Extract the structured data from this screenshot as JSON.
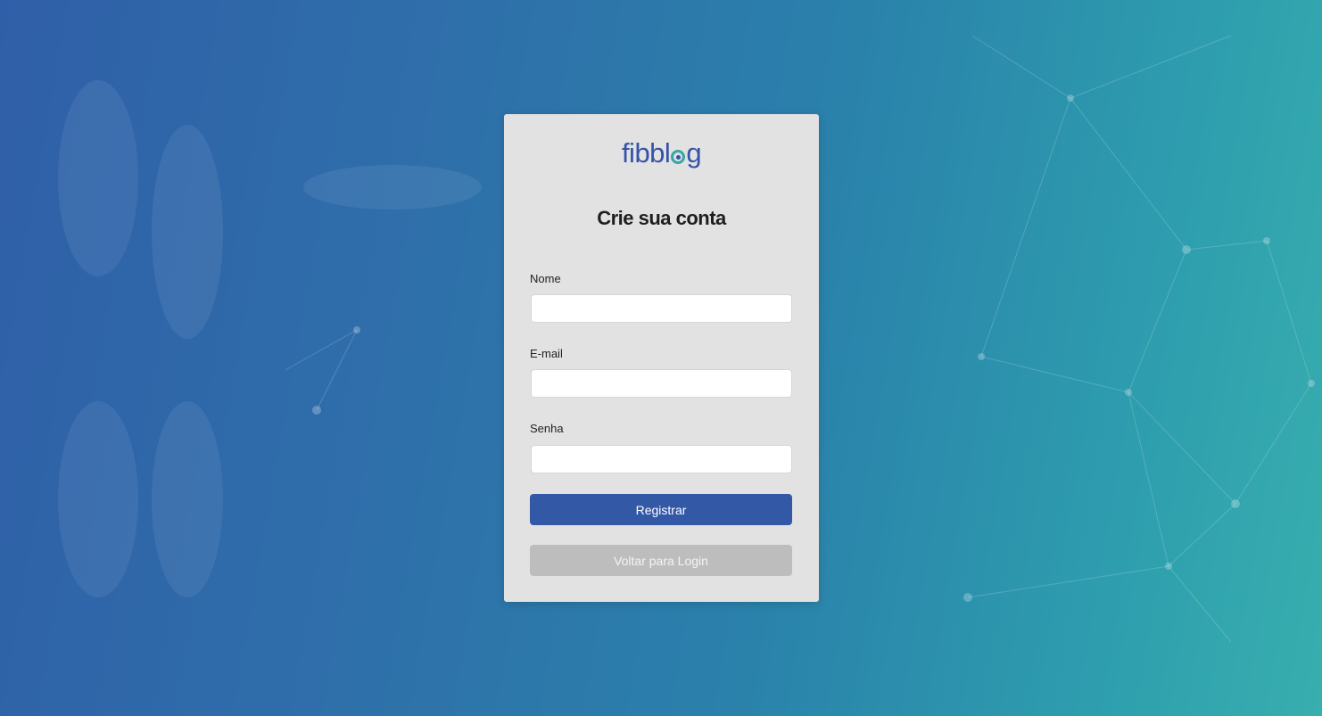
{
  "brand": {
    "logo_before": "fibbl",
    "logo_after": "g",
    "logo_accent": "#3aa5a5",
    "logo_color": "#3553a8"
  },
  "form": {
    "title": "Crie sua conta",
    "fields": [
      {
        "label": "Nome",
        "value": "",
        "placeholder": ""
      },
      {
        "label": "E-mail",
        "value": "",
        "placeholder": ""
      },
      {
        "label": "Senha",
        "value": "",
        "placeholder": ""
      }
    ],
    "submit_label": "Registrar",
    "back_label": "Voltar para Login"
  },
  "colors": {
    "primary": "#3358a6",
    "secondary": "#bdbdbd",
    "card": "#e2e2e2"
  }
}
